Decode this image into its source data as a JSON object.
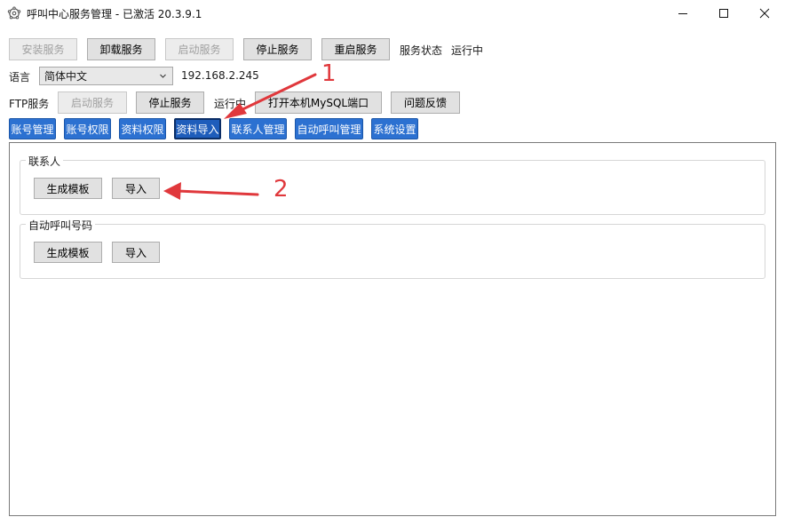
{
  "window": {
    "title": "呼叫中心服务管理 - 已激活  20.3.9.1",
    "icon": "gear-flower-icon"
  },
  "service_bar": {
    "install": "安装服务",
    "uninstall": "卸载服务",
    "start": "启动服务",
    "stop": "停止服务",
    "restart": "重启服务",
    "status_label": "服务状态",
    "status_value": "运行中"
  },
  "language": {
    "label": "语言",
    "selected": "简体中文",
    "ip": "192.168.2.245"
  },
  "ftp_bar": {
    "label": "FTP服务",
    "start": "启动服务",
    "stop": "停止服务",
    "status": "运行中",
    "open_mysql": "打开本机MySQL端口",
    "feedback": "问题反馈"
  },
  "tabs": [
    {
      "label": "账号管理"
    },
    {
      "label": "账号权限"
    },
    {
      "label": "资料权限"
    },
    {
      "label": "资料导入"
    },
    {
      "label": "联系人管理"
    },
    {
      "label": "自动呼叫管理"
    },
    {
      "label": "系统设置"
    }
  ],
  "groups": {
    "contacts": {
      "title": "联系人",
      "gen_template": "生成模板",
      "import": "导入"
    },
    "auto_call": {
      "title": "自动呼叫号码",
      "gen_template": "生成模板",
      "import": "导入"
    }
  },
  "annotations": {
    "one": "1",
    "two": "2",
    "color": "#e0383c"
  },
  "colors": {
    "tab_blue": "#2c71d1",
    "tab_active": "#1e5dbb"
  }
}
